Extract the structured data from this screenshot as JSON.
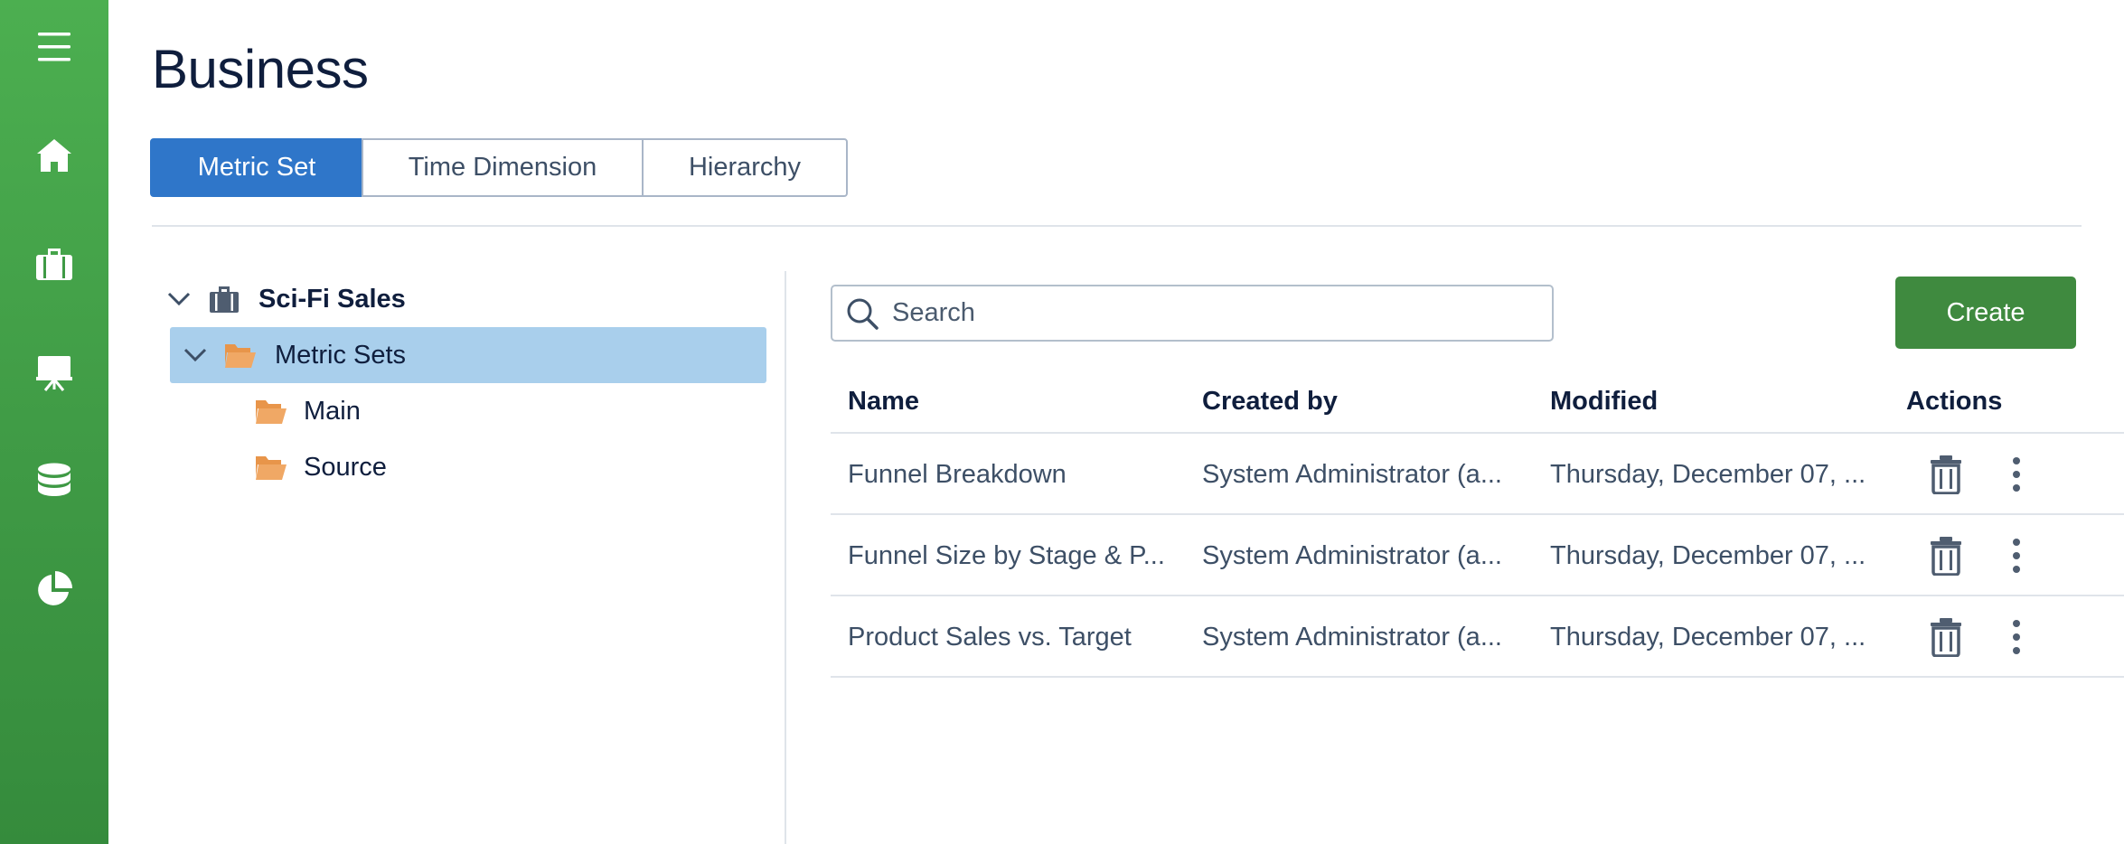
{
  "page": {
    "title": "Business"
  },
  "sidebar": {
    "items": [
      {
        "icon": "menu-icon"
      },
      {
        "icon": "home-icon"
      },
      {
        "icon": "briefcase-icon"
      },
      {
        "icon": "presentation-icon"
      },
      {
        "icon": "database-icon"
      },
      {
        "icon": "pie-chart-icon"
      }
    ]
  },
  "tabs": [
    {
      "label": "Metric Set",
      "active": true
    },
    {
      "label": "Time Dimension",
      "active": false
    },
    {
      "label": "Hierarchy",
      "active": false
    }
  ],
  "tree": {
    "root": {
      "label": "Sci-Fi Sales",
      "icon": "briefcase-icon",
      "expanded": true
    },
    "folder": {
      "label": "Metric Sets",
      "icon": "folder-open-icon",
      "expanded": true,
      "selected": true
    },
    "children": [
      {
        "label": "Main",
        "icon": "folder-open-icon"
      },
      {
        "label": "Source",
        "icon": "folder-open-icon"
      }
    ]
  },
  "search": {
    "placeholder": "Search",
    "value": ""
  },
  "create_button": {
    "label": "Create"
  },
  "table": {
    "columns": [
      "Name",
      "Created by",
      "Modified",
      "Actions"
    ],
    "rows": [
      {
        "name": "Funnel Breakdown",
        "created_by": "System Administrator (a...",
        "modified": "Thursday, December 07, ..."
      },
      {
        "name": "Funnel Size by Stage & P...",
        "created_by": "System Administrator (a...",
        "modified": "Thursday, December 07, ..."
      },
      {
        "name": "Product Sales vs. Target",
        "created_by": "System Administrator (a...",
        "modified": "Thursday, December 07, ..."
      }
    ]
  },
  "colors": {
    "sidebar": "#4caf50",
    "tab_active": "#2f76c9",
    "create_button": "#3f8a3f",
    "tree_selected": "#a9cfec",
    "folder": "#e8954a"
  }
}
